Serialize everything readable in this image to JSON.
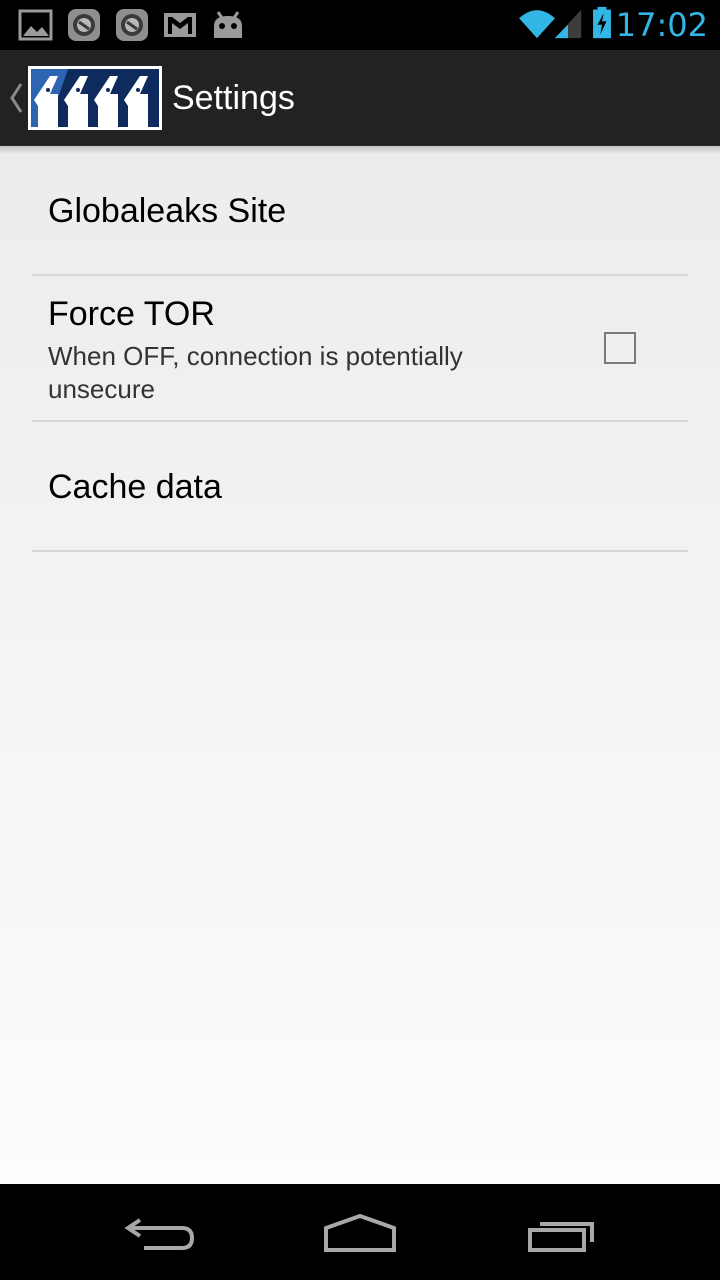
{
  "status_bar": {
    "time": "17:02",
    "accent_color": "#33b5e5",
    "notification_icons": [
      "gallery-icon",
      "app-badge-icon",
      "app-badge-icon",
      "gmail-icon",
      "android-icon"
    ],
    "system_icons": [
      "wifi-icon",
      "signal-icon",
      "battery-charging-icon"
    ]
  },
  "action_bar": {
    "title": "Settings",
    "up_icon": "up-caret-icon",
    "logo": "globaleaks-logo"
  },
  "preferences": [
    {
      "title": "Globaleaks Site",
      "summary": ""
    },
    {
      "title": "Force TOR",
      "summary": "When OFF, connection is potentially unsecure",
      "checked": false
    },
    {
      "title": "Cache data",
      "summary": ""
    }
  ],
  "nav_bar": {
    "buttons": [
      "back-icon",
      "home-icon",
      "recents-icon"
    ]
  }
}
